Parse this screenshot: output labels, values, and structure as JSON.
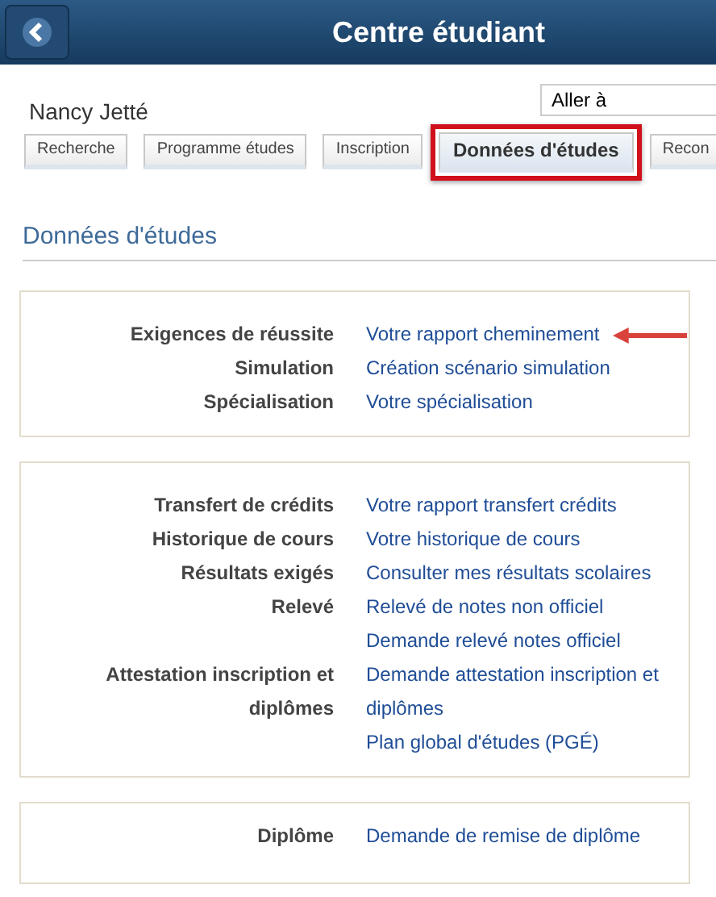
{
  "header": {
    "title": "Centre étudiant"
  },
  "student_name": "Nancy Jetté",
  "goto": {
    "value": "Aller à"
  },
  "tabs": [
    {
      "label": "Recherche",
      "selected": false,
      "highlighted": false
    },
    {
      "label": "Programme études",
      "selected": false,
      "highlighted": false
    },
    {
      "label": "Inscription",
      "selected": false,
      "highlighted": false
    },
    {
      "label": "Données d'études",
      "selected": true,
      "highlighted": true
    },
    {
      "label": "Recon",
      "selected": false,
      "highlighted": false
    }
  ],
  "section_title": "Données d'études",
  "cards": [
    {
      "rows": [
        {
          "label": "Exigences de réussite",
          "links": [
            {
              "text": "Votre rapport cheminement",
              "pointed": true
            }
          ]
        },
        {
          "label": "Simulation",
          "links": [
            {
              "text": "Création scénario simulation",
              "pointed": false
            }
          ]
        },
        {
          "label": "Spécialisation",
          "links": [
            {
              "text": "Votre spécialisation",
              "pointed": false
            }
          ]
        }
      ]
    },
    {
      "rows": [
        {
          "label": "Transfert de crédits",
          "links": [
            {
              "text": "Votre rapport transfert crédits",
              "pointed": false
            }
          ]
        },
        {
          "label": "Historique de cours",
          "links": [
            {
              "text": "Votre historique de cours",
              "pointed": false
            }
          ]
        },
        {
          "label": "Résultats exigés",
          "links": [
            {
              "text": "Consulter mes résultats scolaires",
              "pointed": false
            }
          ]
        },
        {
          "label": "Relevé",
          "links": [
            {
              "text": "Relevé de notes non officiel",
              "pointed": false
            },
            {
              "text": "Demande relevé notes officiel",
              "pointed": false
            }
          ]
        },
        {
          "label": "Attestation inscription et diplômes",
          "links": [
            {
              "text": "Demande attestation inscription et diplômes",
              "pointed": false
            },
            {
              "text": "Plan global d'études (PGÉ)",
              "pointed": false
            }
          ]
        }
      ]
    },
    {
      "rows": [
        {
          "label": "Diplôme",
          "links": [
            {
              "text": "Demande de remise de diplôme",
              "pointed": false
            }
          ]
        }
      ]
    }
  ]
}
